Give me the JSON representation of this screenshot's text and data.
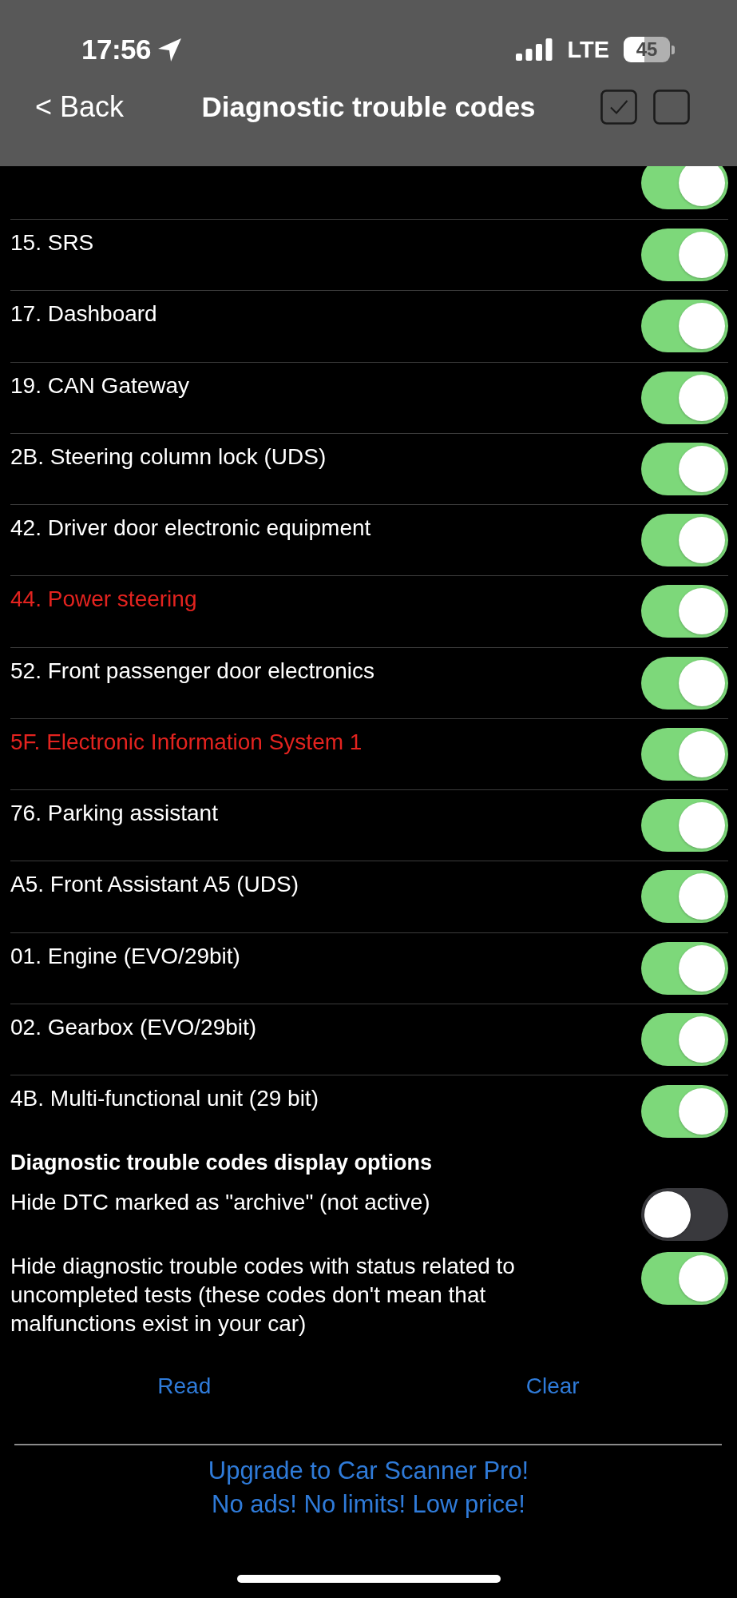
{
  "status_bar": {
    "time": "17:56",
    "network": "LTE",
    "battery": "45"
  },
  "nav_bar": {
    "back": "< Back",
    "title": "Diagnostic trouble codes"
  },
  "modules": [
    {
      "on": true
    },
    {
      "label": "15. SRS",
      "color": "#ffffff",
      "on": true
    },
    {
      "label": "17. Dashboard",
      "color": "#ffffff",
      "on": true
    },
    {
      "label": "19. CAN Gateway",
      "color": "#ffffff",
      "on": true
    },
    {
      "label": "2B. Steering column lock (UDS)",
      "color": "#ffffff",
      "on": true
    },
    {
      "label": "42. Driver door electronic equipment",
      "color": "#ffffff",
      "on": true
    },
    {
      "label": "44. Power steering",
      "color": "#e3231f",
      "on": true
    },
    {
      "label": "52. Front passenger door electronics",
      "color": "#ffffff",
      "on": true
    },
    {
      "label": "5F. Electronic Information System 1",
      "color": "#e3231f",
      "on": true
    },
    {
      "label": "76. Parking assistant",
      "color": "#ffffff",
      "on": true
    },
    {
      "label": "A5. Front Assistant A5 (UDS)",
      "color": "#ffffff",
      "on": true
    },
    {
      "label": "01. Engine (EVO/29bit)",
      "color": "#ffffff",
      "on": true
    },
    {
      "label": "02. Gearbox (EVO/29bit)",
      "color": "#ffffff",
      "on": true
    },
    {
      "label": "4B. Multi-functional unit (29 bit)",
      "color": "#ffffff",
      "on": true
    }
  ],
  "display_options": {
    "title": "Diagnostic trouble codes display options",
    "options": [
      {
        "label": "Hide DTC marked as \"archive\" (not active)",
        "on": false
      },
      {
        "label": "Hide diagnostic trouble codes with status related to uncompleted tests (these codes don't mean that malfunctions exist in your car)",
        "on": true
      }
    ]
  },
  "actions": [
    "Read",
    "Clear"
  ],
  "upgrade_banner": [
    "Upgrade to Car Scanner Pro!",
    "No ads! No limits! Low price!"
  ]
}
